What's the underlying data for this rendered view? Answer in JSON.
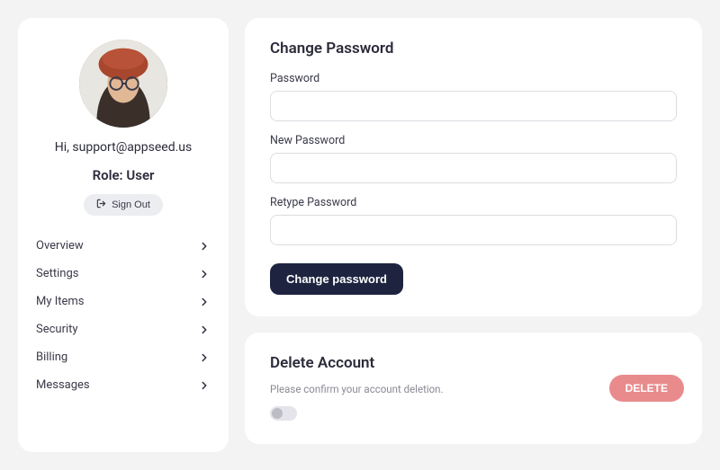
{
  "sidebar": {
    "greeting_prefix": "Hi, ",
    "greeting_email": "support@appseed.us",
    "role_label": "Role: ",
    "role_value": "User",
    "sign_out": "Sign Out",
    "menu": [
      {
        "label": "Overview"
      },
      {
        "label": "Settings"
      },
      {
        "label": "My Items"
      },
      {
        "label": "Security"
      },
      {
        "label": "Billing"
      },
      {
        "label": "Messages"
      }
    ]
  },
  "change_password": {
    "title": "Change Password",
    "password_label": "Password",
    "new_password_label": "New Password",
    "retype_password_label": "Retype Password",
    "submit": "Change password"
  },
  "delete_account": {
    "title": "Delete Account",
    "subtitle": "Please confirm your account deletion.",
    "button": "DELETE"
  }
}
